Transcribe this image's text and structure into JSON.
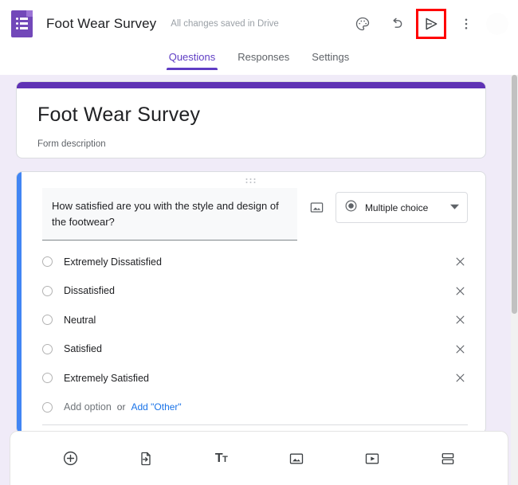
{
  "header": {
    "logo_icon": "google-forms-logo-icon",
    "doc_title": "Foot Wear Survey",
    "save_status": "All changes saved in Drive",
    "theme_icon": "palette-icon",
    "undo_icon": "undo-icon",
    "send_icon": "send-icon",
    "more_icon": "more-vertical-icon",
    "avatar": "account-avatar",
    "highlight_color": "#ff0000"
  },
  "tabs": [
    {
      "label": "Questions",
      "active": true
    },
    {
      "label": "Responses",
      "active": false
    },
    {
      "label": "Settings",
      "active": false
    }
  ],
  "title_card": {
    "form_title": "Foot Wear Survey",
    "form_description": "Form description",
    "accent_color": "#5f32b5"
  },
  "question": {
    "drag_handle_icon": "drag-handle-icon",
    "text": "How satisfied are you with the style and design of the footwear?",
    "image_icon": "add-image-icon",
    "type_icon": "radio-filled-icon",
    "type_label": "Multiple choice",
    "dropdown_icon": "chevron-down-icon",
    "selected_accent_color": "#4285f4",
    "options": [
      {
        "label": "Extremely Dissatisfied",
        "remove_icon": "close-icon"
      },
      {
        "label": "Dissatisfied",
        "remove_icon": "close-icon"
      },
      {
        "label": "Neutral",
        "remove_icon": "close-icon"
      },
      {
        "label": "Satisfied",
        "remove_icon": "close-icon"
      },
      {
        "label": "Extremely Satisfied",
        "remove_icon": "close-icon"
      }
    ],
    "add_option_label": "Add option",
    "or_label": "or",
    "add_other_label": "Add \"Other\""
  },
  "bottom_toolbar": [
    {
      "name": "add-question-button",
      "icon": "plus-circle-icon"
    },
    {
      "name": "import-questions-button",
      "icon": "import-file-icon"
    },
    {
      "name": "add-title-description-button",
      "icon": "title-text-icon",
      "glyph": "T",
      "glyph_small": "T"
    },
    {
      "name": "add-image-button",
      "icon": "image-icon"
    },
    {
      "name": "add-video-button",
      "icon": "video-icon"
    },
    {
      "name": "add-section-button",
      "icon": "section-icon"
    }
  ]
}
